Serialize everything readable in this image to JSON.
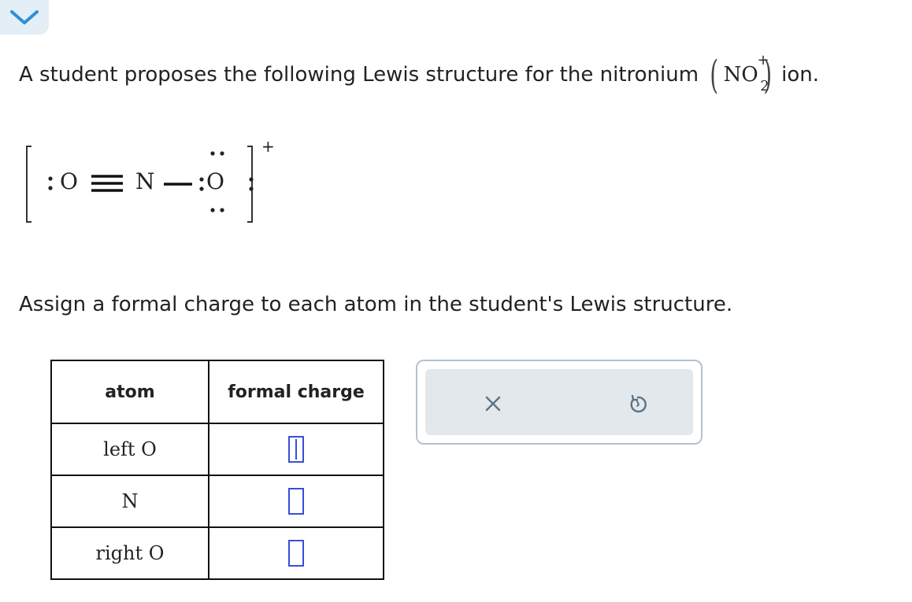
{
  "prompt": {
    "text": "A student proposes the following Lewis structure for the nitronium",
    "suffix": "ion.",
    "formula": {
      "main": "NO",
      "subscript": "2",
      "superscript": "+"
    }
  },
  "lewis": {
    "atoms": [
      "O",
      "N",
      "O"
    ],
    "charge": "+"
  },
  "question": "Assign a formal charge to each atom in the student's Lewis structure.",
  "table": {
    "headers": [
      "atom",
      "formal charge"
    ],
    "rows": [
      {
        "atom": "left O",
        "value": ""
      },
      {
        "atom": "N",
        "value": ""
      },
      {
        "atom": "right O",
        "value": ""
      }
    ]
  },
  "tools": {
    "clear_icon": "close-icon",
    "undo_icon": "undo-icon"
  },
  "colors": {
    "accent": "#3a4fd6",
    "tab": "#e3eef6",
    "panel": "#e3e8ec",
    "icon": "#5b7386"
  }
}
